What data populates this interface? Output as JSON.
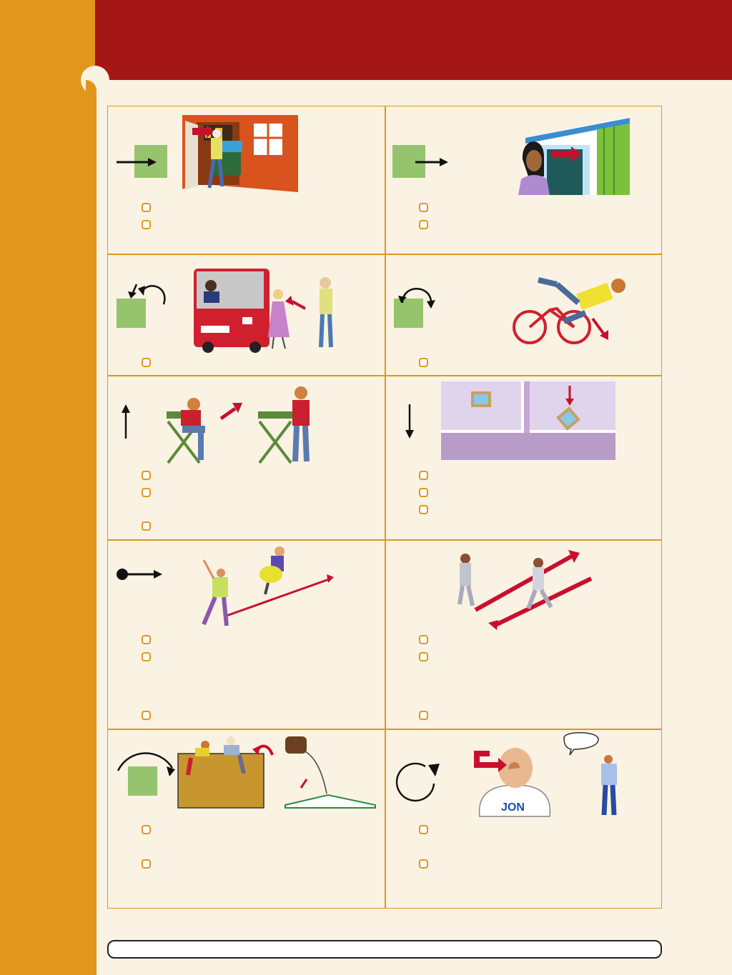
{
  "page": {
    "colors": {
      "accent": "#a51717",
      "band": "#e0971c",
      "panel": "#faf2e3",
      "square": "#96c36e",
      "arrow": "#c8102e"
    }
  },
  "cells": [
    {
      "id": "in",
      "checkbox_count": 2,
      "icons": [
        "arrow-into-square-icon",
        "person-entering-house-picture"
      ]
    },
    {
      "id": "out",
      "checkbox_count": 2,
      "icons": [
        "arrow-out-of-square-icon",
        "woman-looking-out-window-picture"
      ]
    },
    {
      "id": "over-back",
      "checkbox_count": 1,
      "icons": [
        "curved-arrow-back-icon",
        "bus-and-people-picture"
      ]
    },
    {
      "id": "over",
      "checkbox_count": 1,
      "icons": [
        "curved-arrow-over-icon",
        "cyclist-falling-picture"
      ]
    },
    {
      "id": "up",
      "checkbox_count": 3,
      "icons": [
        "up-arrow-icon",
        "man-standing-up-picture"
      ]
    },
    {
      "id": "down",
      "checkbox_count": 3,
      "icons": [
        "down-arrow-icon",
        "picture-falling-down-picture"
      ]
    },
    {
      "id": "on",
      "checkbox_count": 3,
      "icons": [
        "dot-arrow-icon",
        "people-moving-on-picture"
      ]
    },
    {
      "id": "back-and-forth",
      "checkbox_count": 3,
      "icons": [
        "two-men-walking-picture"
      ]
    },
    {
      "id": "over-top",
      "checkbox_count": 2,
      "icons": [
        "arc-over-square-icon",
        "climbing-wall-and-book-picture"
      ]
    },
    {
      "id": "around",
      "checkbox_count": 2,
      "icons": [
        "circular-arrow-icon",
        "boy-turning-around-picture"
      ]
    }
  ],
  "footer": {
    "text": ""
  },
  "jon_shirt": "JON"
}
